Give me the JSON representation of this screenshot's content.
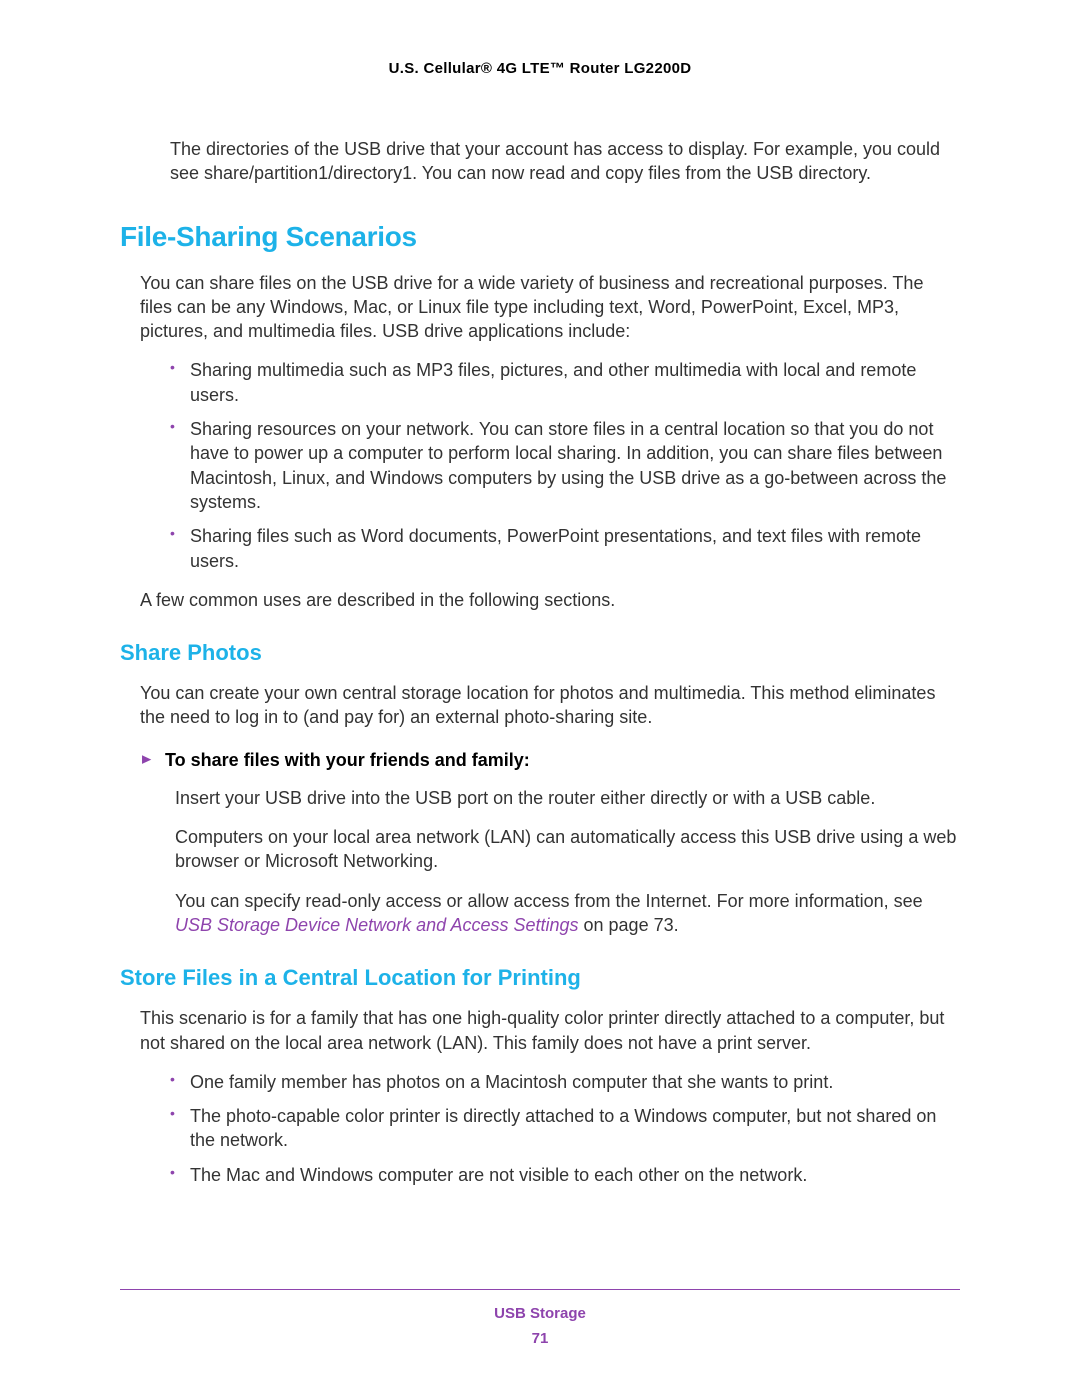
{
  "header": {
    "title": "U.S. Cellular® 4G LTE™ Router LG2200D"
  },
  "intro": {
    "text": "The directories of the USB drive that your account has access to display. For example, you could see share/partition1/directory1. You can now read and copy files from the USB directory."
  },
  "section1": {
    "heading": "File-Sharing Scenarios",
    "para1": "You can share files on the USB drive for a wide variety of business and recreational purposes. The files can be any Windows, Mac, or Linux file type including text, Word, PowerPoint, Excel, MP3, pictures, and multimedia files. USB drive applications include:",
    "bullets": [
      "Sharing multimedia such as MP3 files, pictures, and other multimedia with local and remote users.",
      "Sharing resources on your network. You can store files in a central location so that you do not have to power up a computer to perform local sharing. In addition, you can share files between Macintosh, Linux, and Windows computers by using the USB drive as a go-between across the systems.",
      "Sharing files such as Word documents, PowerPoint presentations, and text files with remote users."
    ],
    "para2": "A few common uses are described in the following sections."
  },
  "section2": {
    "heading": "Share Photos",
    "para1": "You can create your own central storage location for photos and multimedia. This method eliminates the need to log in to (and pay for) an external photo-sharing site.",
    "procedureTitle": "To share files with your friends and family:",
    "step1": "Insert your USB drive into the USB port on the router either directly or with a USB cable.",
    "step2": "Computers on your local area network (LAN) can automatically access this USB drive using a web browser or Microsoft Networking.",
    "step3_before": "You can specify read-only access or allow access from the Internet. For more information, see ",
    "step3_link": "USB Storage Device Network and Access Settings",
    "step3_after": " on page 73."
  },
  "section3": {
    "heading": "Store Files in a Central Location for Printing",
    "para1": "This scenario is for a family that has one high-quality color printer directly attached to a computer, but not shared on the local area network (LAN). This family does not have a print server.",
    "bullets": [
      "One family member has photos on a Macintosh computer that she wants to print.",
      "The photo-capable color printer is directly attached to a Windows computer, but not shared on the network.",
      "The Mac and Windows computer are not visible to each other on the network."
    ]
  },
  "footer": {
    "section": "USB Storage",
    "page": "71"
  }
}
